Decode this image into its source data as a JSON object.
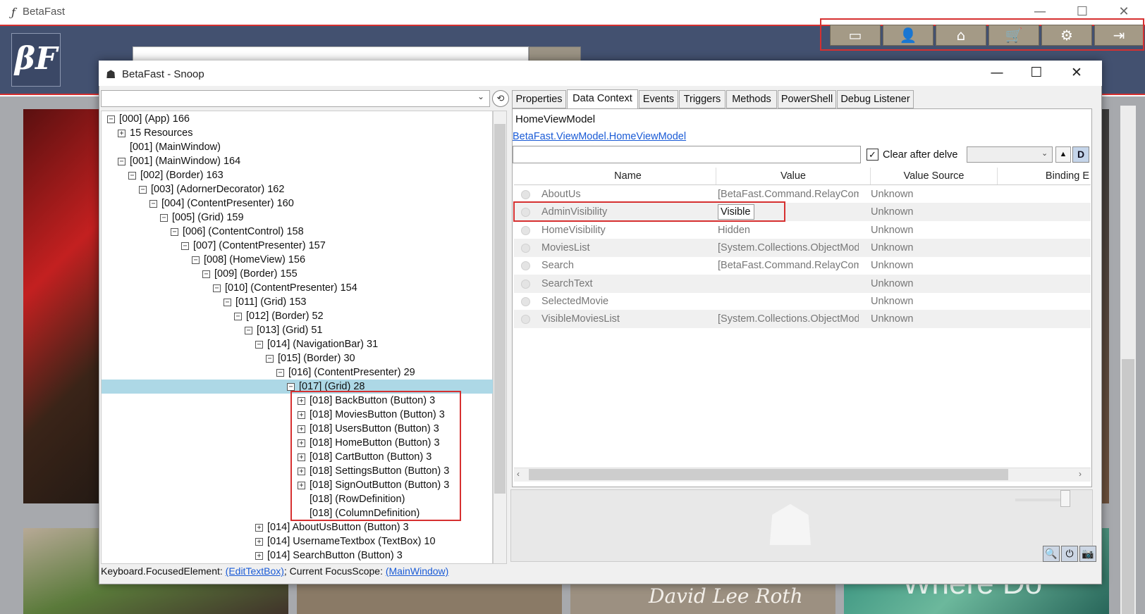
{
  "app": {
    "logo_small": "ƒ",
    "title": "BetaFast",
    "brand_logo": "βF",
    "window_controls": [
      "—",
      "☐",
      "✕"
    ],
    "nav_buttons": [
      {
        "name": "movies",
        "icon": "▭"
      },
      {
        "name": "users",
        "icon": "👤"
      },
      {
        "name": "home",
        "icon": "⌂"
      },
      {
        "name": "cart",
        "icon": "🛒"
      },
      {
        "name": "settings",
        "icon": "⚙"
      },
      {
        "name": "signout",
        "icon": "⇥"
      }
    ],
    "tile_3_text": "David Lee Roth",
    "tile_4_text": "Where Do"
  },
  "snoop": {
    "title": "BetaFast - Snoop",
    "window_controls": [
      "—",
      "☐",
      "✕"
    ],
    "combo_value": "",
    "tree": [
      {
        "exp": "−",
        "text": "[000]  (App) 166",
        "indent": 0
      },
      {
        "exp": "+",
        "text": "15 Resources",
        "indent": 1
      },
      {
        "exp": "",
        "text": "[001]  (MainWindow)",
        "indent": 1
      },
      {
        "exp": "−",
        "text": "[001]  (MainWindow) 164",
        "indent": 1
      },
      {
        "exp": "−",
        "text": "[002]  (Border) 163",
        "indent": 2
      },
      {
        "exp": "−",
        "text": "[003]  (AdornerDecorator) 162",
        "indent": 3
      },
      {
        "exp": "−",
        "text": "[004]  (ContentPresenter) 160",
        "indent": 4
      },
      {
        "exp": "−",
        "text": "[005]  (Grid) 159",
        "indent": 5
      },
      {
        "exp": "−",
        "text": "[006]  (ContentControl) 158",
        "indent": 6
      },
      {
        "exp": "−",
        "text": "[007]  (ContentPresenter) 157",
        "indent": 7
      },
      {
        "exp": "−",
        "text": "[008]  (HomeView) 156",
        "indent": 8
      },
      {
        "exp": "−",
        "text": "[009]  (Border) 155",
        "indent": 9
      },
      {
        "exp": "−",
        "text": "[010]  (ContentPresenter) 154",
        "indent": 10
      },
      {
        "exp": "−",
        "text": "[011]  (Grid) 153",
        "indent": 11
      },
      {
        "exp": "−",
        "text": "[012]  (Border) 52",
        "indent": 12
      },
      {
        "exp": "−",
        "text": "[013]  (Grid) 51",
        "indent": 13
      },
      {
        "exp": "−",
        "text": "[014]  (NavigationBar) 31",
        "indent": 14
      },
      {
        "exp": "−",
        "text": "[015]  (Border) 30",
        "indent": 15
      },
      {
        "exp": "−",
        "text": "[016]  (ContentPresenter) 29",
        "indent": 16
      },
      {
        "exp": "−",
        "text": "[017]  (Grid) 28",
        "indent": 17,
        "selected": true
      },
      {
        "exp": "+",
        "text": "[018] BackButton (Button) 3",
        "indent": 18
      },
      {
        "exp": "+",
        "text": "[018] MoviesButton (Button) 3",
        "indent": 18
      },
      {
        "exp": "+",
        "text": "[018] UsersButton (Button) 3",
        "indent": 18
      },
      {
        "exp": "+",
        "text": "[018] HomeButton (Button) 3",
        "indent": 18
      },
      {
        "exp": "+",
        "text": "[018] CartButton (Button) 3",
        "indent": 18
      },
      {
        "exp": "+",
        "text": "[018] SettingsButton (Button) 3",
        "indent": 18
      },
      {
        "exp": "+",
        "text": "[018] SignOutButton (Button) 3",
        "indent": 18
      },
      {
        "exp": "",
        "text": "[018]  (RowDefinition)",
        "indent": 18
      },
      {
        "exp": "",
        "text": "[018]  (ColumnDefinition)",
        "indent": 18
      },
      {
        "exp": "+",
        "text": "[014] AboutUsButton (Button) 3",
        "indent": 14
      },
      {
        "exp": "+",
        "text": "[014] UsernameTextbox (TextBox) 10",
        "indent": 14
      },
      {
        "exp": "+",
        "text": "[014] SearchButton (Button) 3",
        "indent": 14
      }
    ],
    "status_prefix": "Keyboard.FocusedElement: ",
    "status_focused": "(EditTextBox)",
    "status_mid": "; Current FocusScope: ",
    "status_scope": "(MainWindow)",
    "tabs": [
      "Properties",
      "Data Context",
      "Events",
      "Triggers",
      "Methods",
      "PowerShell",
      "Debug Listener"
    ],
    "active_tab": "Data Context",
    "model_name": "HomeViewModel",
    "model_link": "BetaFast.ViewModel.HomeViewModel",
    "filter_value": "",
    "clear_after_delve_label": "Clear after delve",
    "clear_after_delve_checked": true,
    "d_button": "D",
    "up_button": "▲",
    "columns": [
      "Name",
      "Value",
      "Value Source",
      "Binding E"
    ],
    "rows": [
      {
        "name": "AboutUs",
        "value": "[BetaFast.Command.RelayComi",
        "source": "Unknown"
      },
      {
        "name": "AdminVisibility",
        "value": "Visible",
        "source": "Unknown",
        "editing": true
      },
      {
        "name": "HomeVisibility",
        "value": "Hidden",
        "source": "Unknown"
      },
      {
        "name": "MoviesList",
        "value": "[System.Collections.ObjectMod",
        "source": "Unknown"
      },
      {
        "name": "Search",
        "value": "[BetaFast.Command.RelayComi",
        "source": "Unknown"
      },
      {
        "name": "SearchText",
        "value": "",
        "source": "Unknown"
      },
      {
        "name": "SelectedMovie",
        "value": "",
        "source": "Unknown"
      },
      {
        "name": "VisibleMoviesList",
        "value": "[System.Collections.ObjectMod",
        "source": "Unknown"
      }
    ],
    "toolbar_icons": [
      "🔍",
      "⏻",
      "📷"
    ]
  },
  "colors": {
    "highlight": "#d63030",
    "selection": "#add8e6",
    "header": "#435170",
    "nav_button": "#a49a86"
  }
}
